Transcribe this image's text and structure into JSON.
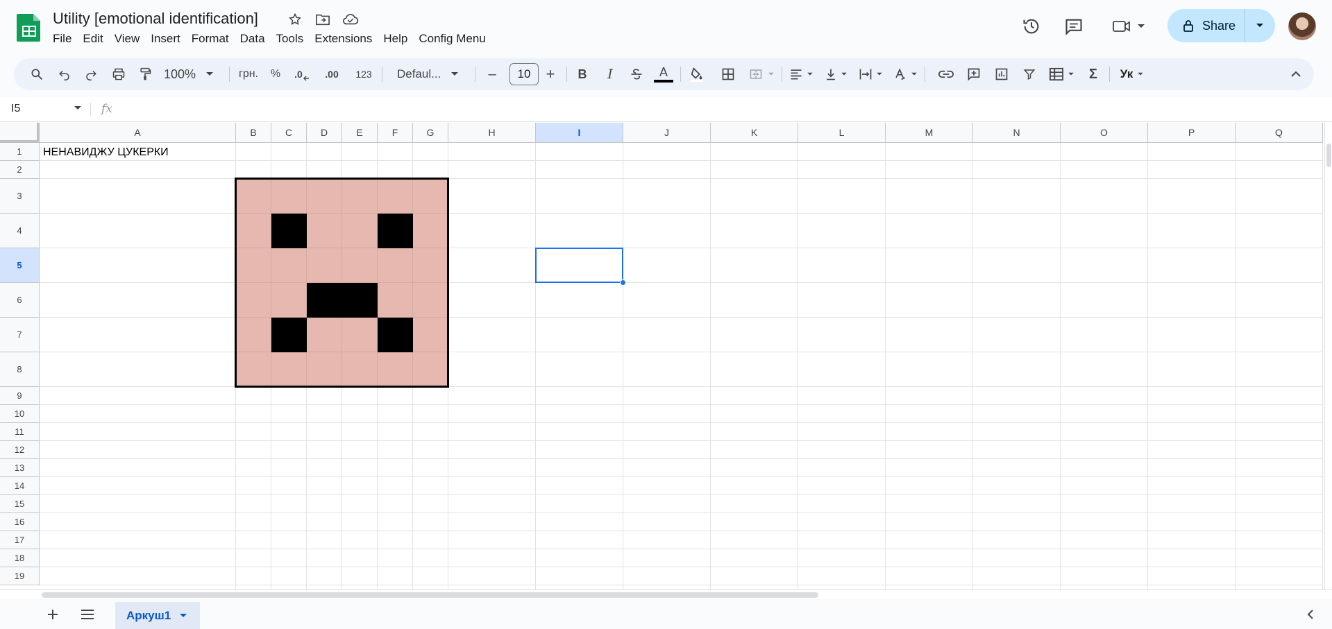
{
  "header": {
    "title": "Utility [emotional identification]",
    "menus": [
      "File",
      "Edit",
      "View",
      "Insert",
      "Format",
      "Data",
      "Tools",
      "Extensions",
      "Help",
      "Config Menu"
    ],
    "share_label": "Share"
  },
  "toolbar": {
    "zoom": "100%",
    "currency": "грн.",
    "percent": "%",
    "dec_decrease": ".0",
    "dec_increase": ".00",
    "number_format": "123",
    "font": "Defaul...",
    "font_size": "10",
    "minus": "–",
    "plus": "+",
    "b": "B",
    "i": "I",
    "text_color_glyph": "A",
    "sigma": "Σ",
    "input_tools": "Ук"
  },
  "formula_bar": {
    "cell_ref": "I5",
    "fx": "fx"
  },
  "grid": {
    "columns": [
      "A",
      "B",
      "C",
      "D",
      "E",
      "F",
      "G",
      "H",
      "I",
      "J",
      "K",
      "L",
      "M",
      "N",
      "O",
      "P",
      "Q"
    ],
    "rows": [
      "1",
      "2",
      "3",
      "4",
      "5",
      "6",
      "7",
      "8",
      "9",
      "10",
      "11",
      "12",
      "13",
      "14",
      "15",
      "16",
      "17",
      "18",
      "19"
    ],
    "selected_column": "I",
    "selected_row": "5",
    "a1_text": "НЕНАВИДЖУ ЦУКЕРКИ",
    "face_colors": {
      "skin": "#e6b8af",
      "feature": "#000000"
    },
    "face_pattern": [
      "pppppp",
      "pbppbp",
      "pppppp",
      "ppbbpp",
      "pbppbp",
      "pppppp"
    ]
  },
  "sheets": {
    "active": "Аркуш1"
  },
  "colors": {
    "accent": "#1a73e8",
    "share_bg": "#c2e7ff",
    "header_selected": "#d3e3fd"
  }
}
